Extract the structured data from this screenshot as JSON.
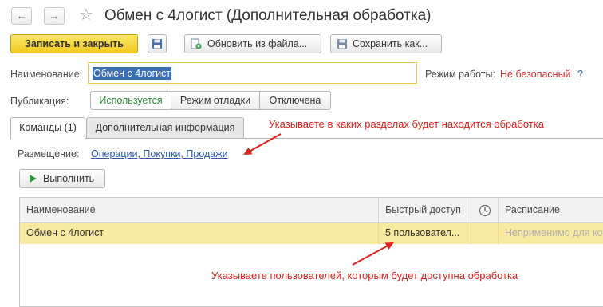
{
  "window": {
    "title": "Обмен с 4логист (Дополнительная обработка)",
    "back_glyph": "←",
    "forward_glyph": "→",
    "star_glyph": "☆"
  },
  "toolbar": {
    "save_close_label": "Записать и закрыть",
    "update_from_file_label": "Обновить из файла...",
    "save_as_label": "Сохранить как..."
  },
  "form": {
    "name_label": "Наименование:",
    "name_value": "Обмен с 4логист",
    "mode_label": "Режим работы:",
    "mode_value": "Не безопасный",
    "mode_help": "?",
    "publication_label": "Публикация:",
    "publication_options": [
      "Используется",
      "Режим отладки",
      "Отключена"
    ],
    "publication_selected": "Используется"
  },
  "tabs": [
    {
      "label": "Команды (1)",
      "active": true
    },
    {
      "label": "Дополнительная информация",
      "active": false
    }
  ],
  "commands": {
    "placement_label": "Размещение:",
    "placement_value": "Операции, Покупки, Продажи",
    "execute_label": "Выполнить",
    "table": {
      "headers": [
        "Наименование",
        "Быстрый доступ",
        "",
        "Расписание"
      ],
      "clock_icon": "clock-icon",
      "rows": [
        {
          "name": "Обмен с 4логист",
          "quick_access": "5 пользовател...",
          "schedule": "Неприменимо для ко"
        }
      ]
    }
  },
  "annotations": {
    "top": "Указываете в каких разделах будет находится обработка",
    "bottom": "Указываете пользователей, которым будет доступна обработка"
  },
  "colors": {
    "primary_button": "#f0cb1e",
    "selected_row": "#f9eaa0",
    "annotation": "#e0201a",
    "link": "#2a59a8",
    "active_option": "#2e8b3a",
    "warning_text": "#d42a2a"
  }
}
